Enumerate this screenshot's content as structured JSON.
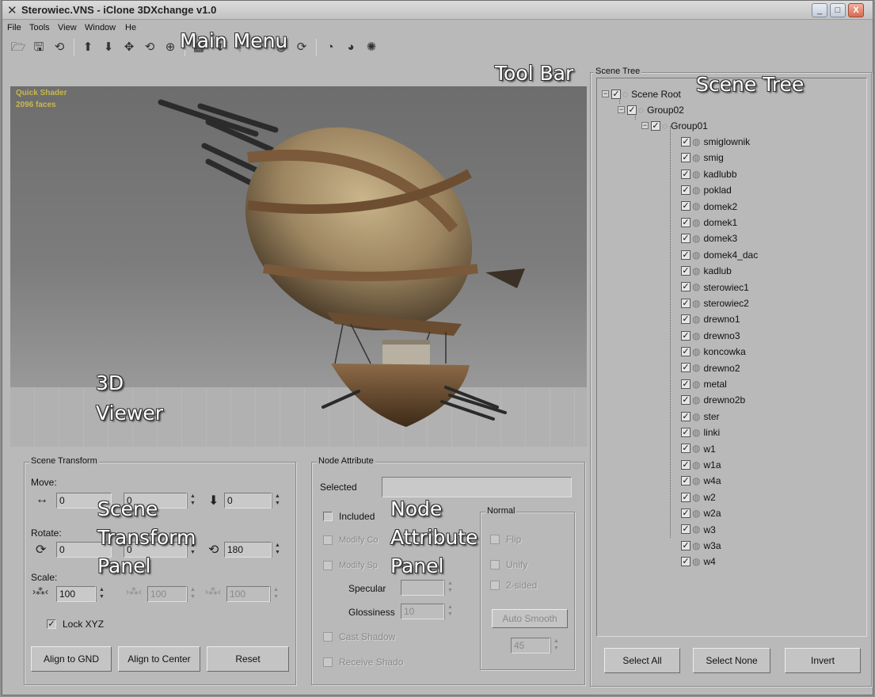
{
  "window": {
    "title": "Sterowiec.VNS - iClone 3DXchange v1.0",
    "minimize": "_",
    "maximize": "□",
    "close": "X"
  },
  "menu": [
    "File",
    "Tools",
    "View",
    "Window",
    "He"
  ],
  "toolbar_icons": [
    "open-icon",
    "save-icon",
    "import-icon",
    "move-up-icon",
    "move-down-icon",
    "move-icon",
    "rotate-icon",
    "scale-icon",
    "grid-icon",
    "pointer-icon",
    "character-icon",
    "light-icon",
    "sphere-icon",
    "refresh-icon",
    "camera-orbit-icon",
    "camera-zoom-icon",
    "camera-pan-icon"
  ],
  "viewer": {
    "shader_label": "Quick Shader",
    "faces_label": "2096 faces"
  },
  "callouts": {
    "main_menu": "Main Menu",
    "tool_bar": "Tool Bar",
    "scene_tree": "Scene Tree",
    "viewer_line1": "3D",
    "viewer_line2": "Viewer",
    "transform_line1": "Scene",
    "transform_line2": "Transform",
    "transform_line3": "Panel",
    "node_line1": "Node",
    "node_line2": "Attribute",
    "node_line3": "Panel"
  },
  "scene_transform": {
    "title": "Scene Transform",
    "move_label": "Move:",
    "move_values": [
      "0",
      "0",
      "0"
    ],
    "rotate_label": "Rotate:",
    "rotate_values": [
      "0",
      "0",
      "180"
    ],
    "scale_label": "Scale:",
    "scale_values": [
      "100",
      "100",
      "100"
    ],
    "lock_label": "Lock XYZ",
    "lock_checked": true,
    "align_gnd": "Align to GND",
    "align_center": "Align to Center",
    "reset": "Reset"
  },
  "node_attribute": {
    "title": "Node Attribute",
    "selected_label": "Selected",
    "selected_value": "",
    "included": "Included",
    "modify_color": "Modify Co",
    "modify_specular": "Modify Sp",
    "specular": "Specular",
    "glossiness": "Glossiness",
    "glossiness_value": "10",
    "cast_shadow": "Cast Shadow",
    "receive_shadow": "Receive Shado",
    "normal_title": "Normal",
    "flip": "Flip",
    "unify": "Unify",
    "two_sided": "2-sided",
    "auto_smooth": "Auto Smooth",
    "smooth_value": "45"
  },
  "scene_tree": {
    "title": "Scene Tree",
    "root": "Scene Root",
    "group02": "Group02",
    "group01": "Group01",
    "items": [
      "smiglownik",
      "smig",
      "kadlubb",
      "poklad",
      "domek2",
      "domek1",
      "domek3",
      "domek4_dac",
      "kadlub",
      "sterowiec1",
      "sterowiec2",
      "drewno1",
      "drewno3",
      "koncowka",
      "drewno2",
      "metal",
      "drewno2b",
      "ster",
      "linki",
      "w1",
      "w1a",
      "w4a",
      "w2",
      "w2a",
      "w3",
      "w3a",
      "w4"
    ],
    "select_all": "Select All",
    "select_none": "Select None",
    "invert": "Invert"
  }
}
